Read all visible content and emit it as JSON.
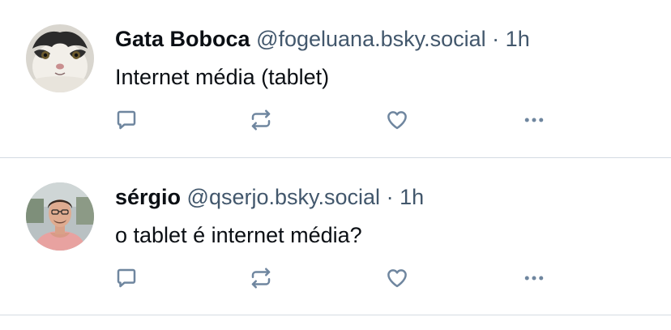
{
  "colors": {
    "text": "#0b0f14",
    "muted": "#42576c",
    "icon": "#6f869f",
    "divider": "#d4dbe2"
  },
  "posts": [
    {
      "display_name": "Gata Boboca",
      "handle": "@fogeluana.bsky.social",
      "separator": "·",
      "time": "1h",
      "text": "Internet média (tablet)",
      "avatar": "cat-avatar",
      "actions": [
        "reply-icon",
        "repost-icon",
        "like-icon",
        "more-icon"
      ]
    },
    {
      "display_name": "sérgio",
      "handle": "@qserjo.bsky.social",
      "separator": "·",
      "time": "1h",
      "text": "o tablet é internet média?",
      "avatar": "person-avatar",
      "actions": [
        "reply-icon",
        "repost-icon",
        "like-icon",
        "more-icon"
      ]
    }
  ]
}
